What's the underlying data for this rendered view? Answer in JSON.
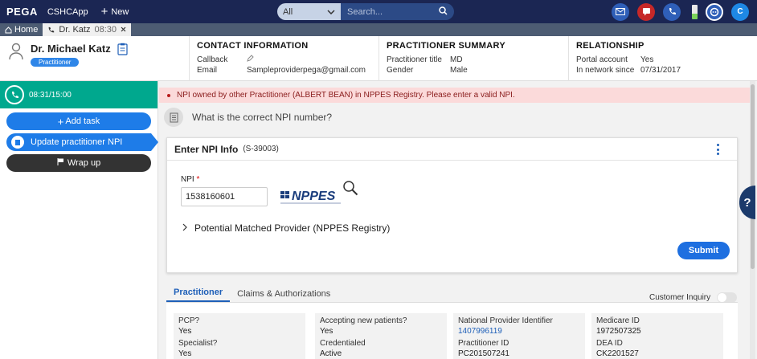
{
  "topbar": {
    "brand": "PEGA",
    "app_name": "CSHCApp",
    "new_label": "New",
    "scope": "All",
    "search_placeholder": "Search...",
    "user_initial": "C"
  },
  "tabs": {
    "home": "Home",
    "active": "Dr. Katz",
    "active_time": "08:30"
  },
  "contact": {
    "name": "Dr. Michael Katz",
    "badge": "Practitioner",
    "contact_info": {
      "title": "CONTACT INFORMATION",
      "callback_label": "Callback",
      "email_label": "Email",
      "email": "Sampleproviderpega@gmail.com"
    },
    "summary": {
      "title": "PRACTITIONER SUMMARY",
      "pt_label": "Practitioner title",
      "pt_value": "MD",
      "gender_label": "Gender",
      "gender_value": "Male"
    },
    "relationship": {
      "title": "RELATIONSHIP",
      "portal_label": "Portal account",
      "portal_value": "Yes",
      "network_label": "In network since",
      "network_value": "07/31/2017"
    }
  },
  "left": {
    "timer": "08:31/15:00",
    "add_task": "Add task",
    "update_npi": "Update practitioner NPI",
    "wrap_up": "Wrap up"
  },
  "main": {
    "alert": "NPI owned by other Practitioner (ALBERT BEAN) in NPPES Registry. Please enter a valid NPI.",
    "question": "What is the correct NPI number?",
    "card_title": "Enter NPI Info",
    "card_case": "(S-39003)",
    "npi_label": "NPI",
    "npi_required": "*",
    "npi_value": "1538160601",
    "nppes_logo": "NPPES",
    "matched_provider": "Potential Matched Provider (NPPES Registry)",
    "submit": "Submit",
    "help": "?"
  },
  "lower_tabs": {
    "practitioner": "Practitioner",
    "claims": "Claims & Authorizations",
    "inquiry": "Customer Inquiry"
  },
  "details": {
    "pcp_label": "PCP?",
    "pcp_value": "Yes",
    "specialist_label": "Specialist?",
    "specialist_value": "Yes",
    "accepting_label": "Accepting new patients?",
    "accepting_value": "Yes",
    "credentialed_label": "Credentialed",
    "credentialed_value": "Active",
    "npi_id_label": "National Provider Identifier",
    "npi_id_value": "1407996119",
    "pract_id_label": "Practitioner ID",
    "pract_id_value": "PC201507241",
    "medicare_label": "Medicare ID",
    "medicare_value": "1972507325",
    "dea_label": "DEA ID",
    "dea_value": "CK2201527"
  },
  "colors": {
    "topbar": "#1b2653",
    "accent": "#1e7ce8",
    "timer": "#00a88e",
    "alert_bg": "#fbdada"
  }
}
